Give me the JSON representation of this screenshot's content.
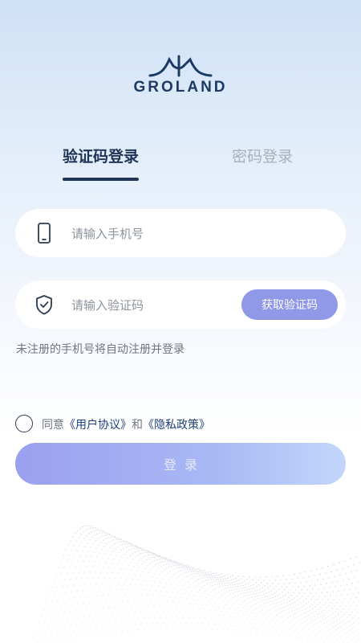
{
  "brand": {
    "name": "GROLAND"
  },
  "tabs": [
    {
      "label": "验证码登录",
      "active": true
    },
    {
      "label": "密码登录",
      "active": false
    }
  ],
  "phone_field": {
    "placeholder": "请输入手机号",
    "value": "",
    "icon": "phone-icon"
  },
  "code_field": {
    "placeholder": "请输入验证码",
    "value": "",
    "icon": "shield-check-icon",
    "button_label": "获取验证码"
  },
  "notice": "未注册的手机号将自动注册并登录",
  "agreement": {
    "prefix": "同意",
    "user_agreement": "《用户协议》",
    "and": "和",
    "privacy_policy": "《隐私政策》",
    "checked": false
  },
  "login_button": {
    "label": "登录"
  },
  "colors": {
    "primary": "#1f3556",
    "accent": "#8f99e7",
    "muted": "#a9aeb8"
  }
}
